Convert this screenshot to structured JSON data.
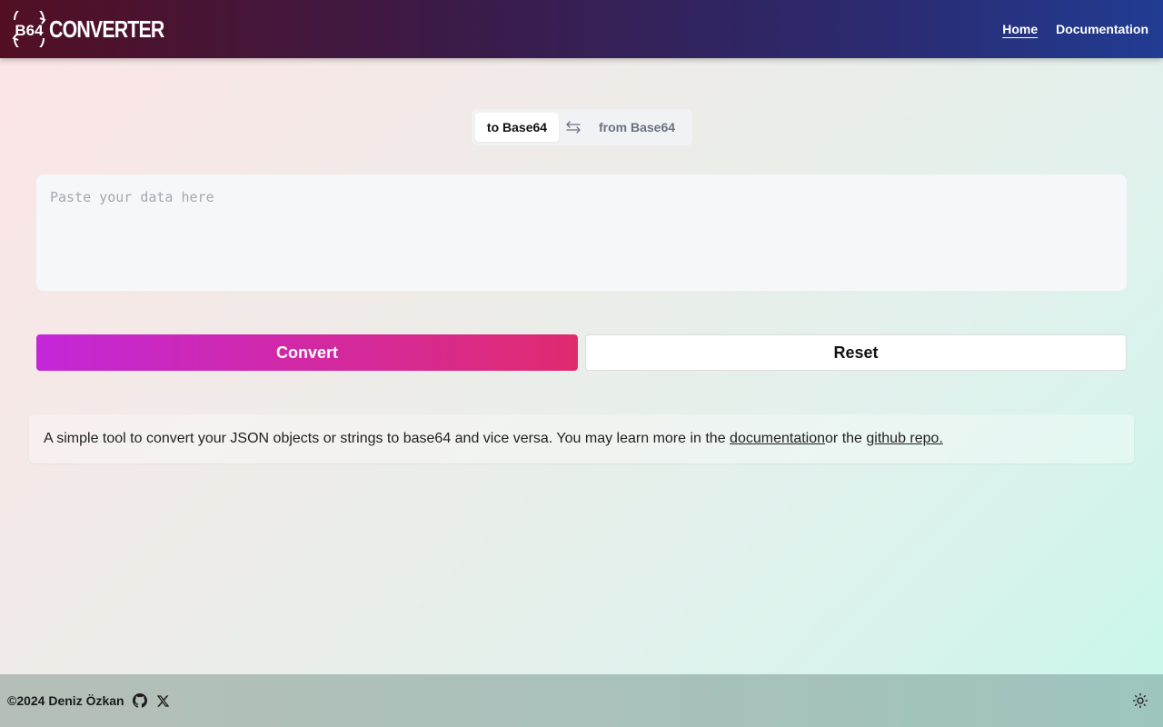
{
  "header": {
    "logo_text": "CONVERTER",
    "logo_badge_text": "B64",
    "nav": [
      {
        "label": "Home",
        "active": true
      },
      {
        "label": "Documentation",
        "active": false
      }
    ]
  },
  "mode_toggle": {
    "options": [
      "to Base64",
      "from Base64"
    ],
    "selected": "to Base64",
    "swap_icon": "swap-arrows-icon"
  },
  "input": {
    "placeholder": "Paste your data here",
    "value": ""
  },
  "actions": {
    "convert_label": "Convert",
    "reset_label": "Reset"
  },
  "info": {
    "text": "A simple tool to convert your JSON objects or strings to base64 and vice versa. You may learn more in the ",
    "doc_link": "documentation",
    "middle_text": "or the ",
    "repo_link": "github repo."
  },
  "footer": {
    "copyright": "©2024 Deniz Özkan",
    "icons": [
      "github-icon",
      "x-icon"
    ],
    "theme_icon": "sun-icon"
  },
  "colors": {
    "convert_start": "#c327d8",
    "convert_end": "#e02a6f",
    "header_start": "#520f24",
    "header_end": "#213c92"
  }
}
